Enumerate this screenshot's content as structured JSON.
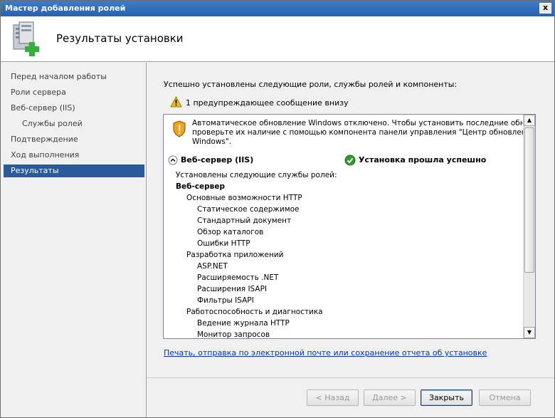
{
  "window": {
    "title": "Мастер добавления ролей",
    "close_glyph": "x"
  },
  "header": {
    "title": "Результаты установки",
    "icon": "server-add-icon"
  },
  "nav": {
    "items": [
      {
        "label": "Перед началом работы",
        "sub": false,
        "active": false
      },
      {
        "label": "Роли сервера",
        "sub": false,
        "active": false
      },
      {
        "label": "Веб-сервер (IIS)",
        "sub": false,
        "active": false
      },
      {
        "label": "Службы ролей",
        "sub": true,
        "active": false
      },
      {
        "label": "Подтверждение",
        "sub": false,
        "active": false
      },
      {
        "label": "Ход выполнения",
        "sub": false,
        "active": false
      },
      {
        "label": "Результаты",
        "sub": false,
        "active": true
      }
    ]
  },
  "main": {
    "intro": "Успешно установлены следующие роли, службы ролей и компоненты:",
    "warning_summary": "1 предупреждающее сообщение внизу",
    "message": {
      "lines": [
        "Автоматическое обновление Windows отключено. Чтобы установить последние обновлени",
        "проверьте их наличие с помощью компонента панели управления \"Центр обновления",
        "Windows\"."
      ]
    },
    "role": {
      "name": "Веб-сервер (IIS)",
      "status": "Установка прошла успешно"
    },
    "details": [
      {
        "text": "Установлены следующие службы ролей:",
        "level": 0,
        "bold": false
      },
      {
        "text": "Веб-сервер",
        "level": 0,
        "bold": true
      },
      {
        "text": "Основные возможности HTTP",
        "level": 1,
        "bold": false
      },
      {
        "text": "Статическое содержимое",
        "level": 2,
        "bold": false
      },
      {
        "text": "Стандартный документ",
        "level": 2,
        "bold": false
      },
      {
        "text": "Обзор каталогов",
        "level": 2,
        "bold": false
      },
      {
        "text": "Ошибки HTTP",
        "level": 2,
        "bold": false
      },
      {
        "text": "Разработка приложений",
        "level": 1,
        "bold": false
      },
      {
        "text": "ASP.NET",
        "level": 2,
        "bold": false
      },
      {
        "text": "Расширяемость .NET",
        "level": 2,
        "bold": false
      },
      {
        "text": "Расширения ISAPI",
        "level": 2,
        "bold": false
      },
      {
        "text": "Фильтры ISAPI",
        "level": 2,
        "bold": false
      },
      {
        "text": "Работоспособность и диагностика",
        "level": 1,
        "bold": false
      },
      {
        "text": "Ведение журнала HTTP",
        "level": 2,
        "bold": false
      },
      {
        "text": "Монитор запросов",
        "level": 2,
        "bold": false
      }
    ],
    "report_link": "Печать, отправка по электронной почте или сохранение отчета об установке"
  },
  "buttons": {
    "back": "< Назад",
    "next": "Далее >",
    "close": "Закрыть",
    "cancel": "Отмена"
  },
  "colors": {
    "title_bar": "#2a62ac",
    "nav_active": "#2a5a9c",
    "link": "#0033cc",
    "success": "#2f9a2f",
    "warning": "#f0c020"
  }
}
